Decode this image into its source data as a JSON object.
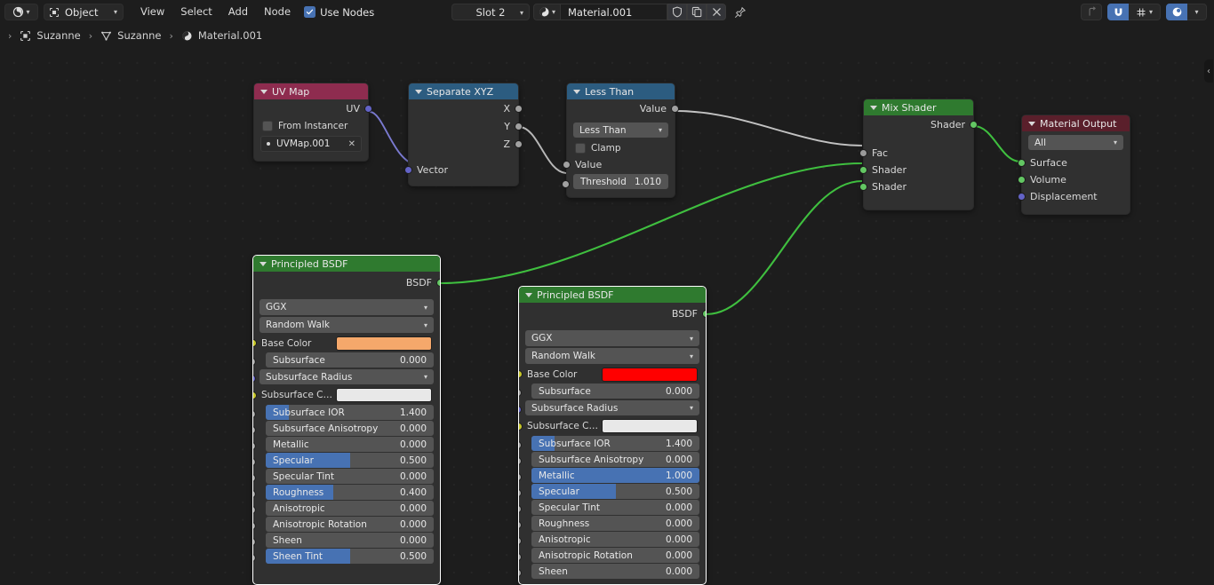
{
  "header": {
    "editor_type_icon": "shader-editor-icon",
    "shader_type_label": "Object",
    "menus": [
      "View",
      "Select",
      "Add",
      "Node"
    ],
    "use_nodes_label": "Use Nodes",
    "use_nodes_checked": true,
    "slot_label": "Slot 2",
    "material_name": "Material.001",
    "material_icon": "material-sphere-icon",
    "fake_user_icon": "shield-icon",
    "new_material_icon": "copy-icon",
    "unlink_icon": "close-icon",
    "pin_icon": "pin-icon",
    "snap_icon": "magnet-icon",
    "snap_target_icon": "snap-grid-icon",
    "overlay_icon": "overlays-icon",
    "parent_icon": "go-to-parent-icon"
  },
  "breadcrumb": {
    "items": [
      {
        "icon": "object-icon",
        "label": "Suzanne"
      },
      {
        "icon": "mesh-data-icon",
        "label": "Suzanne"
      },
      {
        "icon": "material-icon",
        "label": "Material.001"
      }
    ]
  },
  "canvas": {
    "collapse_arrow": "‹"
  },
  "nodes": {
    "uv_map": {
      "title": "UV Map",
      "header_color": "#8e2c4f",
      "outputs": [
        {
          "label": "UV",
          "type": "vector"
        }
      ],
      "from_instancer_label": "From Instancer",
      "uv_name": "UVMap.001"
    },
    "separate_xyz": {
      "title": "Separate XYZ",
      "header_color": "#2c5c80",
      "outputs": [
        {
          "label": "X",
          "type": "value"
        },
        {
          "label": "Y",
          "type": "value"
        },
        {
          "label": "Z",
          "type": "value"
        }
      ],
      "inputs": [
        {
          "label": "Vector",
          "type": "vector"
        }
      ]
    },
    "less_than": {
      "title": "Less Than",
      "header_color": "#2c5c80",
      "outputs": [
        {
          "label": "Value",
          "type": "value"
        }
      ],
      "operation": "Less Than",
      "clamp_label": "Clamp",
      "clamp_checked": false,
      "input_value_label": "Value",
      "threshold_label": "Threshold",
      "threshold_value": "1.010"
    },
    "mix_shader": {
      "title": "Mix Shader",
      "header_color": "#2f7a2f",
      "outputs": [
        {
          "label": "Shader",
          "type": "shader"
        }
      ],
      "inputs": [
        {
          "label": "Fac",
          "type": "value"
        },
        {
          "label": "Shader",
          "type": "shader"
        },
        {
          "label": "Shader",
          "type": "shader"
        }
      ]
    },
    "material_output": {
      "title": "Material Output",
      "header_color": "#5a1f2b",
      "target": "All",
      "inputs": [
        {
          "label": "Surface",
          "type": "shader"
        },
        {
          "label": "Volume",
          "type": "shader"
        },
        {
          "label": "Displacement",
          "type": "vector"
        }
      ]
    },
    "bsdf_left": {
      "title": "Principled BSDF",
      "header_color": "#2f7a2f",
      "output_label": "BSDF",
      "distribution": "GGX",
      "subsurface_method": "Random Walk",
      "base_color_label": "Base Color",
      "base_color": "#f5a86b",
      "subsurface_color_label": "Subsurface C…",
      "subsurface_color": "#e8e8e8",
      "subsurface_radius_label": "Subsurface Radius",
      "props": [
        {
          "label": "Subsurface",
          "value": "0.000",
          "fill": 0.0
        },
        {
          "label": "Subsurface IOR",
          "value": "1.400",
          "fill": 0.14
        },
        {
          "label": "Subsurface Anisotropy",
          "value": "0.000",
          "fill": 0.0
        },
        {
          "label": "Metallic",
          "value": "0.000",
          "fill": 0.0
        },
        {
          "label": "Specular",
          "value": "0.500",
          "fill": 0.5
        },
        {
          "label": "Specular Tint",
          "value": "0.000",
          "fill": 0.0
        },
        {
          "label": "Roughness",
          "value": "0.400",
          "fill": 0.4
        },
        {
          "label": "Anisotropic",
          "value": "0.000",
          "fill": 0.0
        },
        {
          "label": "Anisotropic Rotation",
          "value": "0.000",
          "fill": 0.0
        },
        {
          "label": "Sheen",
          "value": "0.000",
          "fill": 0.0
        },
        {
          "label": "Sheen Tint",
          "value": "0.500",
          "fill": 0.5
        }
      ]
    },
    "bsdf_right": {
      "title": "Principled BSDF",
      "header_color": "#2f7a2f",
      "output_label": "BSDF",
      "distribution": "GGX",
      "subsurface_method": "Random Walk",
      "base_color_label": "Base Color",
      "base_color": "#ff0000",
      "subsurface_color_label": "Subsurface C…",
      "subsurface_color": "#e8e8e8",
      "subsurface_radius_label": "Subsurface Radius",
      "props": [
        {
          "label": "Subsurface",
          "value": "0.000",
          "fill": 0.0
        },
        {
          "label": "Subsurface IOR",
          "value": "1.400",
          "fill": 0.14
        },
        {
          "label": "Subsurface Anisotropy",
          "value": "0.000",
          "fill": 0.0
        },
        {
          "label": "Metallic",
          "value": "1.000",
          "fill": 1.0
        },
        {
          "label": "Specular",
          "value": "0.500",
          "fill": 0.5
        },
        {
          "label": "Specular Tint",
          "value": "0.000",
          "fill": 0.0
        },
        {
          "label": "Roughness",
          "value": "0.000",
          "fill": 0.0
        },
        {
          "label": "Anisotropic",
          "value": "0.000",
          "fill": 0.0
        },
        {
          "label": "Anisotropic Rotation",
          "value": "0.000",
          "fill": 0.0
        },
        {
          "label": "Sheen",
          "value": "0.000",
          "fill": 0.0
        }
      ]
    }
  }
}
